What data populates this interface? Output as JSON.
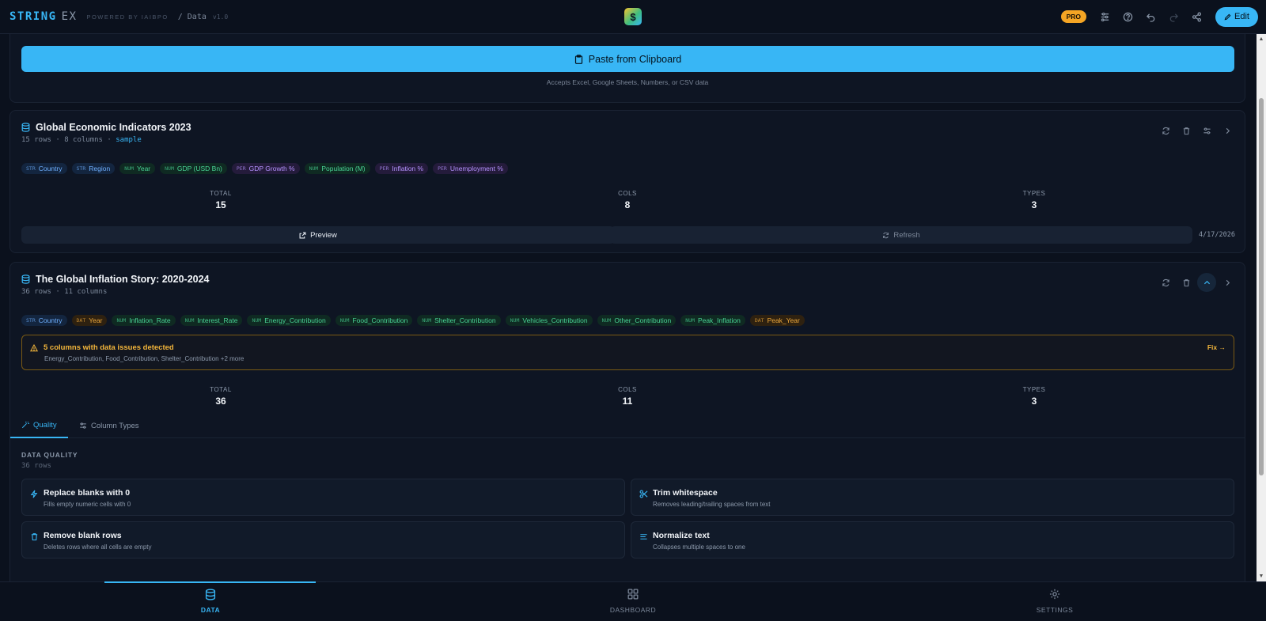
{
  "header": {
    "brand": "STRING",
    "brand_suffix": "EX",
    "powered": "POWERED BY IAIBPO",
    "breadcrumb": "/ Data",
    "version": "v1.0",
    "pro_badge": "PRO",
    "edit_label": "Edit"
  },
  "paste": {
    "button_label": "Paste from Clipboard",
    "hint": "Accepts Excel, Google Sheets, Numbers, or CSV data"
  },
  "datasets": [
    {
      "title": "Global Economic Indicators 2023",
      "rows": "15 rows",
      "cols": "8 columns",
      "tag": "sample",
      "columns": [
        {
          "type": "STR",
          "name": "Country"
        },
        {
          "type": "STR",
          "name": "Region"
        },
        {
          "type": "NUM",
          "name": "Year"
        },
        {
          "type": "NUM",
          "name": "GDP (USD Bn)"
        },
        {
          "type": "PER",
          "name": "GDP Growth %"
        },
        {
          "type": "NUM",
          "name": "Population (M)"
        },
        {
          "type": "PER",
          "name": "Inflation %"
        },
        {
          "type": "PER",
          "name": "Unemployment %"
        }
      ],
      "stats": [
        {
          "label": "TOTAL",
          "value": "15"
        },
        {
          "label": "COLS",
          "value": "8"
        },
        {
          "label": "TYPES",
          "value": "3"
        }
      ],
      "preview_label": "Preview",
      "refresh_label": "Refresh",
      "date": "4/17/2026"
    },
    {
      "title": "The Global Inflation Story: 2020-2024",
      "rows": "36 rows",
      "cols": "11 columns",
      "columns": [
        {
          "type": "STR",
          "name": "Country"
        },
        {
          "type": "DAT",
          "name": "Year"
        },
        {
          "type": "NUM",
          "name": "Inflation_Rate"
        },
        {
          "type": "NUM",
          "name": "Interest_Rate"
        },
        {
          "type": "NUM",
          "name": "Energy_Contribution"
        },
        {
          "type": "NUM",
          "name": "Food_Contribution"
        },
        {
          "type": "NUM",
          "name": "Shelter_Contribution"
        },
        {
          "type": "NUM",
          "name": "Vehicles_Contribution"
        },
        {
          "type": "NUM",
          "name": "Other_Contribution"
        },
        {
          "type": "NUM",
          "name": "Peak_Inflation"
        },
        {
          "type": "DAT",
          "name": "Peak_Year"
        }
      ],
      "issues": {
        "title": "5 columns with data issues detected",
        "detail": "Energy_Contribution, Food_Contribution, Shelter_Contribution +2 more",
        "fix_label": "Fix →"
      },
      "stats": [
        {
          "label": "TOTAL",
          "value": "36"
        },
        {
          "label": "COLS",
          "value": "11"
        },
        {
          "label": "TYPES",
          "value": "3"
        }
      ],
      "tabs": [
        "Quality",
        "Column Types"
      ],
      "quality": {
        "label": "DATA QUALITY",
        "rows": "36 rows",
        "actions": [
          {
            "icon": "zap-icon",
            "title": "Replace blanks with 0",
            "desc": "Fills empty numeric cells with 0"
          },
          {
            "icon": "scissors-icon",
            "title": "Trim whitespace",
            "desc": "Removes leading/trailing spaces from text"
          },
          {
            "icon": "trash-icon",
            "title": "Remove blank rows",
            "desc": "Deletes rows where all cells are empty"
          },
          {
            "icon": "align-icon",
            "title": "Normalize text",
            "desc": "Collapses multiple spaces to one"
          }
        ]
      }
    }
  ],
  "nav": [
    {
      "label": "DATA",
      "icon": "database-icon",
      "active": true
    },
    {
      "label": "DASHBOARD",
      "icon": "grid-icon",
      "active": false
    },
    {
      "label": "SETTINGS",
      "icon": "gear-icon",
      "active": false
    }
  ],
  "colors": {
    "accent": "#38b6f5",
    "background": "#0b111d",
    "warning": "#f5b73b",
    "pro": "#f5a524"
  }
}
